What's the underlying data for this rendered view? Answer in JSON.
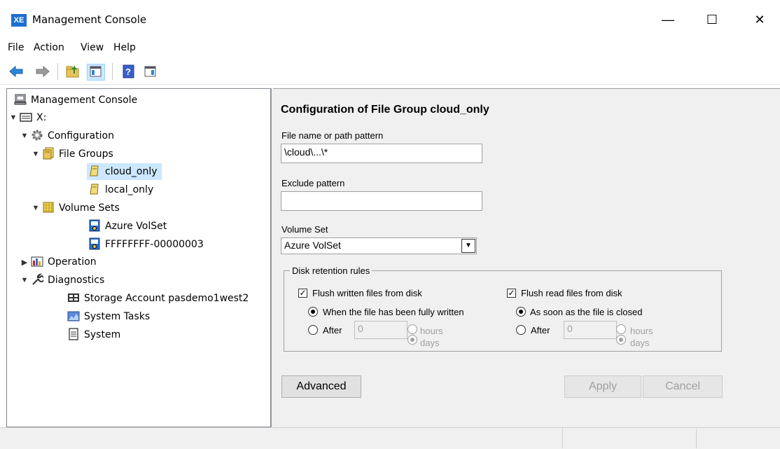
{
  "window": {
    "logo": "XE",
    "title": "Management Console",
    "minimize": "—",
    "maximize": "☐",
    "close": "✕"
  },
  "menu": [
    "File",
    "Action",
    "View",
    "Help"
  ],
  "toolbar": {
    "icons": [
      "back-arrow-icon",
      "forward-arrow-icon",
      "up-folder-icon",
      "show-hide-tree-icon",
      "help-icon",
      "action-pane-icon"
    ]
  },
  "tree": {
    "root": "Management Console",
    "server": "X:",
    "configuration": "Configuration",
    "file_groups": "File Groups",
    "cloud_only": "cloud_only",
    "local_only": "local_only",
    "volume_sets": "Volume Sets",
    "azure_volset": "Azure VolSet",
    "ffff_volset": "FFFFFFFF-00000003",
    "operation": "Operation",
    "diagnostics": "Diagnostics",
    "storage_account": "Storage Account pasdemo1west2",
    "system_tasks": "System Tasks",
    "system": "System"
  },
  "form": {
    "heading": "Configuration of File Group cloud_only",
    "path_label": "File name or path pattern",
    "path_value": "\\cloud\\...\\*",
    "exclude_label": "Exclude pattern",
    "exclude_value": "",
    "volume_label": "Volume Set",
    "volume_value": "Azure VolSet",
    "retention_legend": "Disk retention rules",
    "write": {
      "checkbox_label": "Flush written files from disk",
      "checked": true,
      "option1": "When the file has been fully written",
      "option2": "After",
      "value": "0",
      "unit_hours": "hours",
      "unit_days": "days"
    },
    "read": {
      "checkbox_label": "Flush read files from disk",
      "checked": true,
      "option1": "As soon as the file is closed",
      "option2": "After",
      "value": "0",
      "unit_hours": "hours",
      "unit_days": "days"
    },
    "buttons": {
      "advanced": "Advanced",
      "apply": "Apply",
      "cancel": "Cancel"
    }
  }
}
